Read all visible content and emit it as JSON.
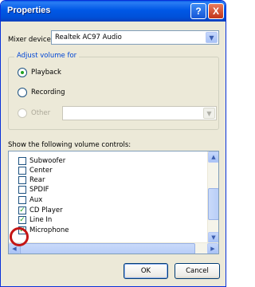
{
  "window": {
    "title": "Properties",
    "help_label": "?",
    "close_label": "X"
  },
  "mixer": {
    "label": "Mixer device:",
    "selected": "Realtek AC97 Audio"
  },
  "volume_group": {
    "label": "Adjust volume for",
    "options": [
      {
        "label": "Playback",
        "checked": true,
        "enabled": true
      },
      {
        "label": "Recording",
        "checked": false,
        "enabled": true
      },
      {
        "label": "Other",
        "checked": false,
        "enabled": false
      }
    ],
    "other_selected": ""
  },
  "controls": {
    "label": "Show the following volume controls:",
    "items": [
      {
        "label": "Subwoofer",
        "checked": false
      },
      {
        "label": "Center",
        "checked": false
      },
      {
        "label": "Rear",
        "checked": false
      },
      {
        "label": "SPDIF",
        "checked": false
      },
      {
        "label": "Aux",
        "checked": false
      },
      {
        "label": "CD Player",
        "checked": true
      },
      {
        "label": "Line In",
        "checked": true
      },
      {
        "label": "Microphone",
        "checked": true
      }
    ]
  },
  "buttons": {
    "ok": "OK",
    "cancel": "Cancel"
  },
  "icons": {
    "scroll_up": "chevron-up-icon",
    "scroll_down": "chevron-down-icon",
    "scroll_left": "chevron-left-icon",
    "scroll_right": "chevron-right-icon"
  },
  "colors": {
    "titlebar": "#0058e6",
    "accent_check": "#21a121",
    "annotation": "#c41616"
  }
}
